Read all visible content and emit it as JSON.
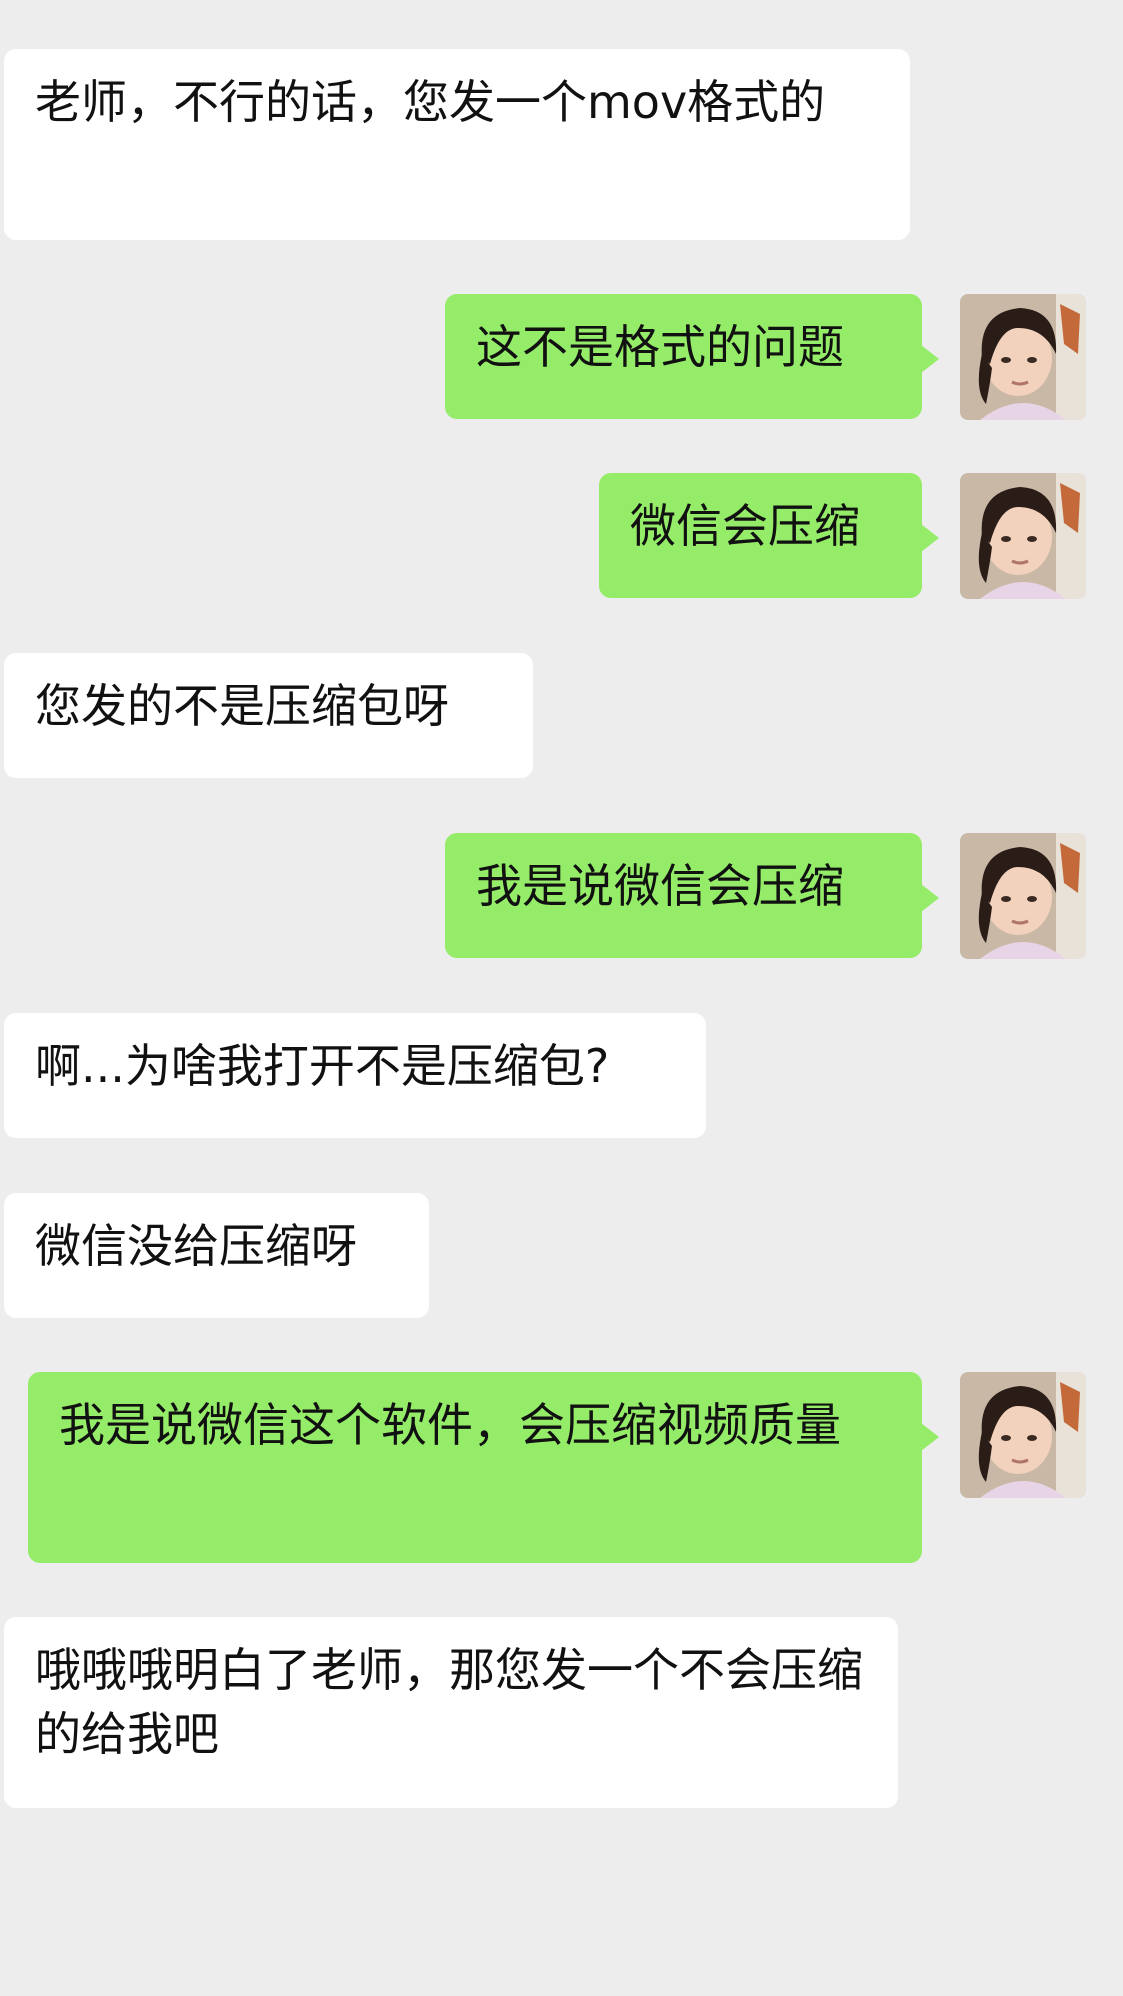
{
  "messages": [
    {
      "side": "in",
      "text": "老师，不行的话，您发一个mov格式的"
    },
    {
      "side": "out",
      "text": "这不是格式的问题"
    },
    {
      "side": "out",
      "text": "微信会压缩"
    },
    {
      "side": "in",
      "text": "您发的不是压缩包呀"
    },
    {
      "side": "out",
      "text": "我是说微信会压缩"
    },
    {
      "side": "in",
      "text": "啊...为啥我打开不是压缩包?"
    },
    {
      "side": "in",
      "text": "微信没给压缩呀"
    },
    {
      "side": "out",
      "text": "我是说微信这个软件，会压缩视频质量"
    },
    {
      "side": "in",
      "text": "哦哦哦明白了老师，那您发一个不会压缩的给我吧"
    }
  ],
  "avatar_icon": "user-avatar-photo",
  "colors": {
    "background": "#ededed",
    "incoming_bubble": "#ffffff",
    "outgoing_bubble": "#95ec69",
    "text": "#111111"
  }
}
